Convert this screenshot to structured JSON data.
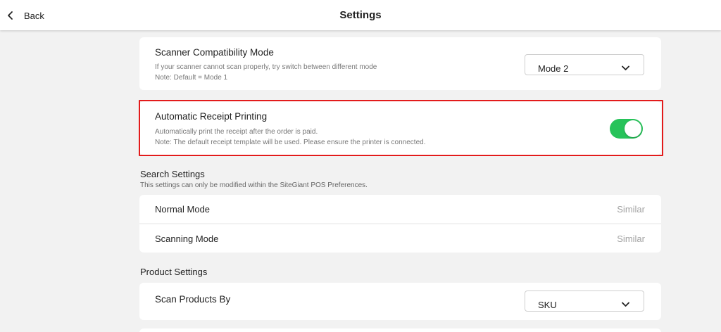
{
  "header": {
    "back_label": "Back",
    "title": "Settings"
  },
  "scanner": {
    "title": "Scanner Compatibility Mode",
    "desc_line1": "If your scanner cannot scan properly, try switch between different mode",
    "desc_line2": "Note: Default = Mode 1",
    "selected": "Mode 2"
  },
  "receipt": {
    "title": "Automatic Receipt Printing",
    "desc_line1": "Automatically print the receipt after the order is paid.",
    "desc_line2": "Note: The default receipt template will be used. Please ensure the printer is connected.",
    "enabled": true
  },
  "search_settings": {
    "title": "Search Settings",
    "subtitle": "This settings can only be modified within the SiteGiant POS Preferences.",
    "rows": [
      {
        "label": "Normal Mode",
        "value": "Similar"
      },
      {
        "label": "Scanning Mode",
        "value": "Similar"
      }
    ]
  },
  "product_settings": {
    "title": "Product Settings",
    "scan_by_label": "Scan Products By",
    "scan_by_value": "SKU"
  },
  "colors": {
    "toggle_on": "#27c35a",
    "highlight_border": "#e31b1b",
    "background": "#f2f2f2"
  }
}
